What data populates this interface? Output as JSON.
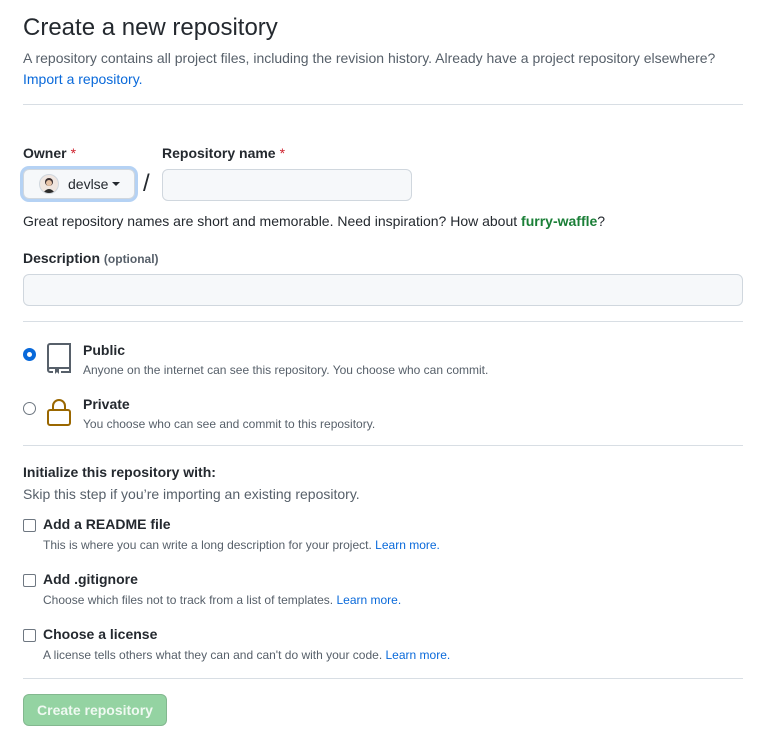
{
  "header": {
    "title": "Create a new repository",
    "subtitle": "A repository contains all project files, including the revision history. Already have a project repository elsewhere?",
    "import_link": "Import a repository."
  },
  "owner": {
    "label": "Owner",
    "required_mark": "*",
    "selected": "devlse"
  },
  "repo_name": {
    "label": "Repository name",
    "required_mark": "*",
    "value": "",
    "separator": "/"
  },
  "hint": {
    "text": "Great repository names are short and memorable. Need inspiration? How about ",
    "suggestion": "furry-waffle",
    "end": "?"
  },
  "description": {
    "label": "Description",
    "optional": "(optional)",
    "value": ""
  },
  "visibility": {
    "selected": "public",
    "options": [
      {
        "title": "Public",
        "note": "Anyone on the internet can see this repository. You choose who can commit.",
        "icon": "repo-icon"
      },
      {
        "title": "Private",
        "note": "You choose who can see and commit to this repository.",
        "icon": "lock-icon"
      }
    ]
  },
  "init": {
    "heading": "Initialize this repository with:",
    "subheading": "Skip this step if you’re importing an existing repository.",
    "options": [
      {
        "title": "Add a README file",
        "note": "This is where you can write a long description for your project.",
        "link": "Learn more.",
        "checked": false
      },
      {
        "title": "Add .gitignore",
        "note": "Choose which files not to track from a list of templates.",
        "link": "Learn more.",
        "checked": false
      },
      {
        "title": "Choose a license",
        "note": "A license tells others what they can and can't do with your code.",
        "link": "Learn more.",
        "checked": false
      }
    ]
  },
  "submit": {
    "label": "Create repository",
    "disabled": true
  },
  "colors": {
    "accent": "#0969da",
    "success": "#1a7f37",
    "button_disabled": "#94d3a2",
    "required": "#cf222e",
    "lock_icon": "#9a6700"
  }
}
